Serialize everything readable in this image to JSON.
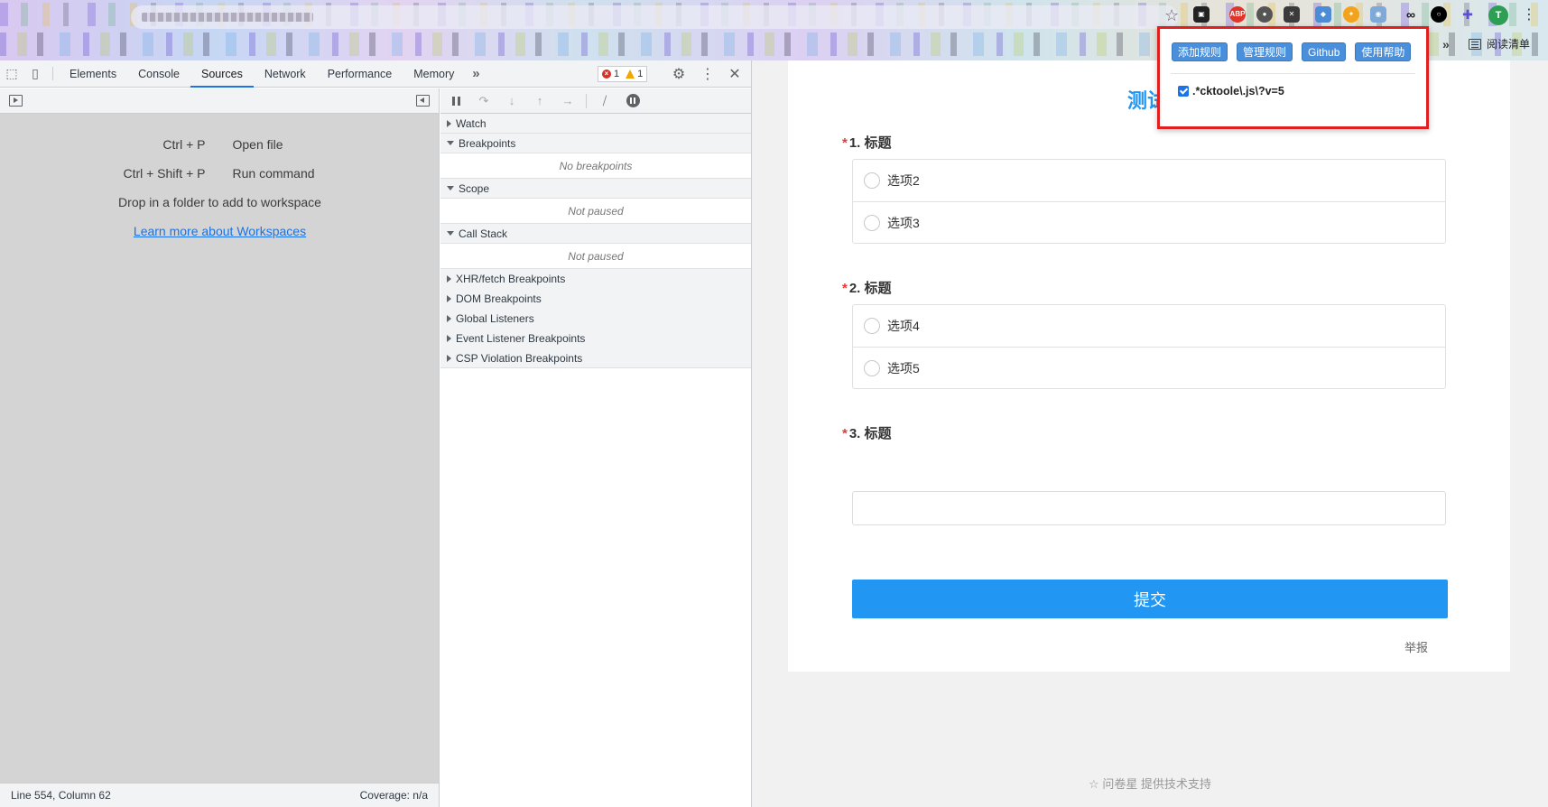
{
  "devtools": {
    "tabs": [
      "Elements",
      "Console",
      "Sources",
      "Network",
      "Performance",
      "Memory"
    ],
    "active_tab": "Sources",
    "error_count": "1",
    "warning_count": "1",
    "navigator": {
      "shortcut_open_key": "Ctrl + P",
      "shortcut_open_label": "Open file",
      "shortcut_run_key": "Ctrl + Shift + P",
      "shortcut_run_label": "Run command",
      "drop_hint": "Drop in a folder to add to workspace",
      "learn_more": "Learn more about Workspaces",
      "status_position": "Line 554, Column 62",
      "status_coverage": "Coverage: n/a"
    },
    "debugger": {
      "watch": "Watch",
      "breakpoints": "Breakpoints",
      "no_breakpoints": "No breakpoints",
      "scope": "Scope",
      "scope_empty": "Not paused",
      "call_stack": "Call Stack",
      "call_stack_empty": "Not paused",
      "more_panes": [
        "XHR/fetch Breakpoints",
        "DOM Breakpoints",
        "Global Listeners",
        "Event Listener Breakpoints",
        "CSP Violation Breakpoints"
      ]
    }
  },
  "browser": {
    "reading_list": "阅读清单",
    "avatar_letter": "T",
    "extensions": [
      "ABP"
    ]
  },
  "page": {
    "survey_title": "测试",
    "questions": [
      {
        "number": "1. 标题",
        "options": [
          "选项2",
          "选项3"
        ]
      },
      {
        "number": "2. 标题",
        "options": [
          "选项4",
          "选项5"
        ]
      },
      {
        "number": "3. 标题"
      }
    ],
    "required_mark": "*",
    "submit": "提交",
    "report": "举报",
    "footer": "☆ 问卷星 提供技术支持"
  },
  "popup": {
    "buttons": [
      "添加规则",
      "管理规则",
      "Github",
      "使用帮助"
    ],
    "rule_text": ".*cktoole\\.js\\?v=5",
    "rule_checked": true
  },
  "colors": {
    "accent": "#2196f3",
    "devtools_active": "#1a73e8",
    "popup_border": "#e02020"
  }
}
